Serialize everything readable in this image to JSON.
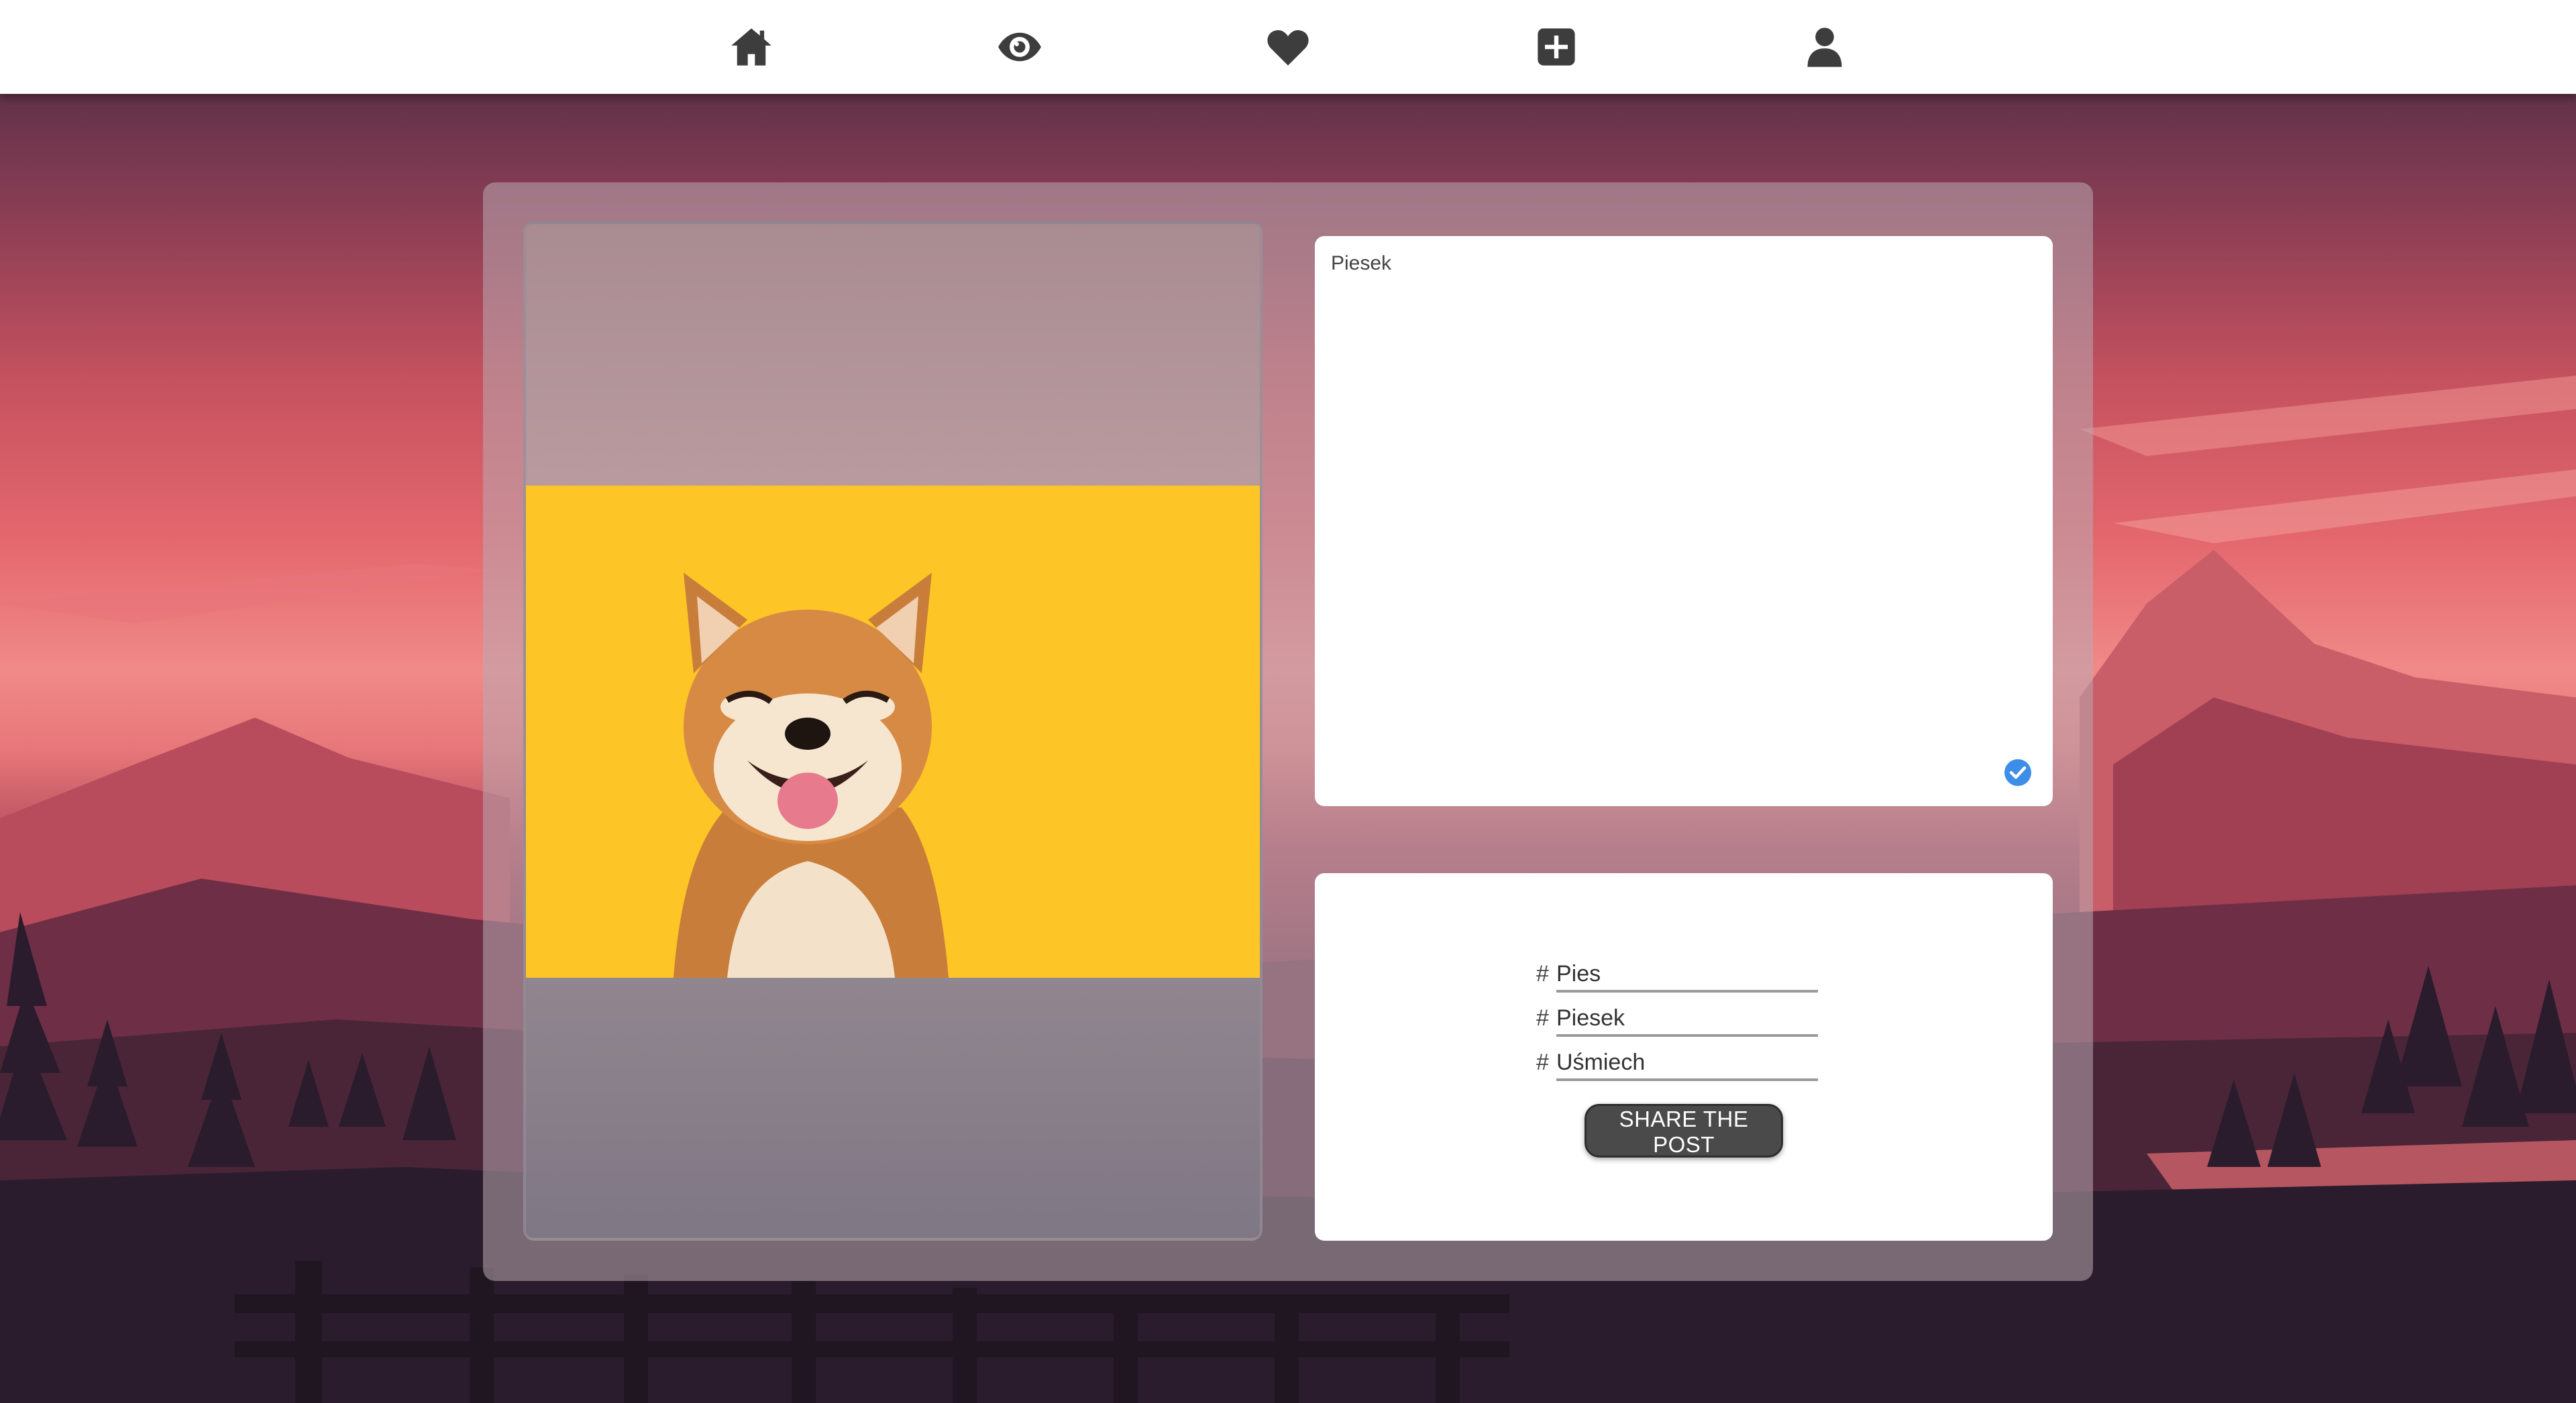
{
  "nav": {
    "items": [
      {
        "icon": "home-icon"
      },
      {
        "icon": "eye-icon"
      },
      {
        "icon": "heart-icon"
      },
      {
        "icon": "add-post-icon"
      },
      {
        "icon": "user-icon"
      }
    ],
    "icon_color": "#3d3d3d"
  },
  "post": {
    "image": {
      "subject": "dog-photo",
      "background_color": "#fdc526"
    },
    "description": "Piesek",
    "check_icon_color": "#3d8ee8",
    "tags": [
      {
        "hash": "#",
        "value": "Pies"
      },
      {
        "hash": "#",
        "value": "Piesek"
      },
      {
        "hash": "#",
        "value": "Uśmiech"
      }
    ],
    "share_label": "SHARE THE POST"
  },
  "colors": {
    "button_bg": "#4a4a4a",
    "card_bg": "#ffffff"
  }
}
